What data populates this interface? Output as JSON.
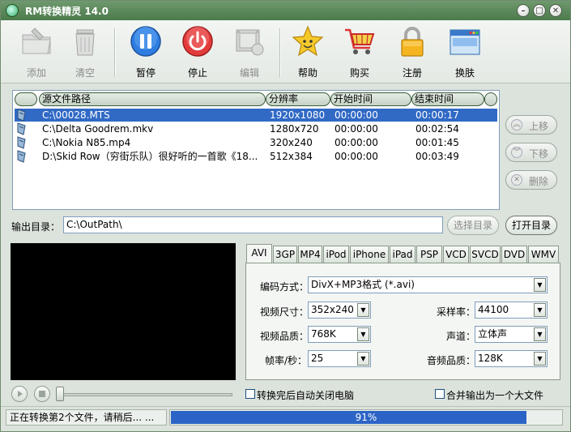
{
  "window": {
    "title": "RM转换精灵 14.0"
  },
  "toolbar": {
    "add": "添加",
    "clear": "清空",
    "pause": "暂停",
    "stop": "停止",
    "edit": "编辑",
    "help": "帮助",
    "buy": "购买",
    "register": "注册",
    "skin": "换肤"
  },
  "list": {
    "headers": [
      "源文件路径",
      "分辨率",
      "开始时间",
      "结束时间"
    ],
    "rows": [
      {
        "path": "C:\\00028.MTS",
        "resolution": "1920x1080",
        "start": "00:00:00",
        "end": "00:00:17"
      },
      {
        "path": "C:\\Delta Goodrem.mkv",
        "resolution": "1280x720",
        "start": "00:00:00",
        "end": "00:02:54"
      },
      {
        "path": "C:\\Nokia N85.mp4",
        "resolution": "320x240",
        "start": "00:00:00",
        "end": "00:01:45"
      },
      {
        "path": "D:\\Skid Row（穷街乐队）很好听的一首歌《18...",
        "resolution": "512x384",
        "start": "00:00:00",
        "end": "00:03:49"
      }
    ]
  },
  "side": {
    "up": "上移",
    "down": "下移",
    "delete": "删除"
  },
  "output": {
    "label": "输出目录：",
    "path": "C:\\OutPath\\",
    "select": "选择目录",
    "open": "打开目录"
  },
  "tabs": [
    "AVI",
    "3GP",
    "MP4",
    "iPod",
    "iPhone",
    "iPad",
    "PSP",
    "VCD",
    "SVCD",
    "DVD",
    "WMV"
  ],
  "settings": {
    "codec_label": "编码方式：",
    "codec": "DivX+MP3格式 (*.avi)",
    "size_label": "视频尺寸：",
    "size": "352x240",
    "quality_label": "视频品质：",
    "quality": "768K",
    "fps_label": "帧率/秒：",
    "fps": "25",
    "sample_label": "采样率：",
    "sample": "44100",
    "channel_label": "声道：",
    "channel": "立体声",
    "audio_label": "音频品质：",
    "audio": "128K"
  },
  "options": {
    "shutdown": "转换完后自动关闭电脑",
    "merge": "合并输出为一个大文件"
  },
  "status": {
    "text": "正在转换第2个文件，请稍后... ...",
    "progress_text": "91%",
    "progress": 0.91
  }
}
